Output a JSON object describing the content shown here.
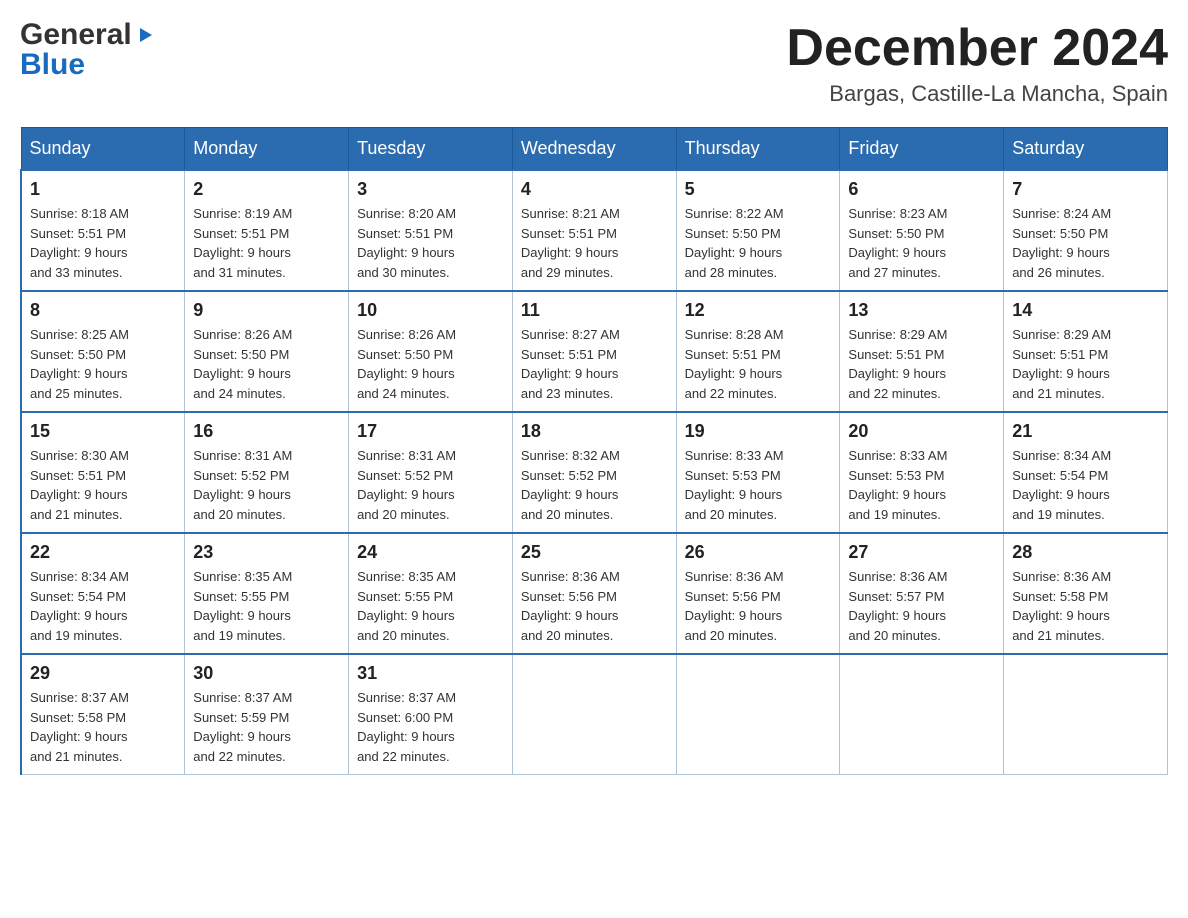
{
  "header": {
    "logo_general": "General",
    "logo_blue": "Blue",
    "month_title": "December 2024",
    "location": "Bargas, Castille-La Mancha, Spain"
  },
  "weekdays": [
    "Sunday",
    "Monday",
    "Tuesday",
    "Wednesday",
    "Thursday",
    "Friday",
    "Saturday"
  ],
  "weeks": [
    [
      {
        "day": "1",
        "sunrise": "8:18 AM",
        "sunset": "5:51 PM",
        "daylight": "9 hours and 33 minutes."
      },
      {
        "day": "2",
        "sunrise": "8:19 AM",
        "sunset": "5:51 PM",
        "daylight": "9 hours and 31 minutes."
      },
      {
        "day": "3",
        "sunrise": "8:20 AM",
        "sunset": "5:51 PM",
        "daylight": "9 hours and 30 minutes."
      },
      {
        "day": "4",
        "sunrise": "8:21 AM",
        "sunset": "5:51 PM",
        "daylight": "9 hours and 29 minutes."
      },
      {
        "day": "5",
        "sunrise": "8:22 AM",
        "sunset": "5:50 PM",
        "daylight": "9 hours and 28 minutes."
      },
      {
        "day": "6",
        "sunrise": "8:23 AM",
        "sunset": "5:50 PM",
        "daylight": "9 hours and 27 minutes."
      },
      {
        "day": "7",
        "sunrise": "8:24 AM",
        "sunset": "5:50 PM",
        "daylight": "9 hours and 26 minutes."
      }
    ],
    [
      {
        "day": "8",
        "sunrise": "8:25 AM",
        "sunset": "5:50 PM",
        "daylight": "9 hours and 25 minutes."
      },
      {
        "day": "9",
        "sunrise": "8:26 AM",
        "sunset": "5:50 PM",
        "daylight": "9 hours and 24 minutes."
      },
      {
        "day": "10",
        "sunrise": "8:26 AM",
        "sunset": "5:50 PM",
        "daylight": "9 hours and 24 minutes."
      },
      {
        "day": "11",
        "sunrise": "8:27 AM",
        "sunset": "5:51 PM",
        "daylight": "9 hours and 23 minutes."
      },
      {
        "day": "12",
        "sunrise": "8:28 AM",
        "sunset": "5:51 PM",
        "daylight": "9 hours and 22 minutes."
      },
      {
        "day": "13",
        "sunrise": "8:29 AM",
        "sunset": "5:51 PM",
        "daylight": "9 hours and 22 minutes."
      },
      {
        "day": "14",
        "sunrise": "8:29 AM",
        "sunset": "5:51 PM",
        "daylight": "9 hours and 21 minutes."
      }
    ],
    [
      {
        "day": "15",
        "sunrise": "8:30 AM",
        "sunset": "5:51 PM",
        "daylight": "9 hours and 21 minutes."
      },
      {
        "day": "16",
        "sunrise": "8:31 AM",
        "sunset": "5:52 PM",
        "daylight": "9 hours and 20 minutes."
      },
      {
        "day": "17",
        "sunrise": "8:31 AM",
        "sunset": "5:52 PM",
        "daylight": "9 hours and 20 minutes."
      },
      {
        "day": "18",
        "sunrise": "8:32 AM",
        "sunset": "5:52 PM",
        "daylight": "9 hours and 20 minutes."
      },
      {
        "day": "19",
        "sunrise": "8:33 AM",
        "sunset": "5:53 PM",
        "daylight": "9 hours and 20 minutes."
      },
      {
        "day": "20",
        "sunrise": "8:33 AM",
        "sunset": "5:53 PM",
        "daylight": "9 hours and 19 minutes."
      },
      {
        "day": "21",
        "sunrise": "8:34 AM",
        "sunset": "5:54 PM",
        "daylight": "9 hours and 19 minutes."
      }
    ],
    [
      {
        "day": "22",
        "sunrise": "8:34 AM",
        "sunset": "5:54 PM",
        "daylight": "9 hours and 19 minutes."
      },
      {
        "day": "23",
        "sunrise": "8:35 AM",
        "sunset": "5:55 PM",
        "daylight": "9 hours and 19 minutes."
      },
      {
        "day": "24",
        "sunrise": "8:35 AM",
        "sunset": "5:55 PM",
        "daylight": "9 hours and 20 minutes."
      },
      {
        "day": "25",
        "sunrise": "8:36 AM",
        "sunset": "5:56 PM",
        "daylight": "9 hours and 20 minutes."
      },
      {
        "day": "26",
        "sunrise": "8:36 AM",
        "sunset": "5:56 PM",
        "daylight": "9 hours and 20 minutes."
      },
      {
        "day": "27",
        "sunrise": "8:36 AM",
        "sunset": "5:57 PM",
        "daylight": "9 hours and 20 minutes."
      },
      {
        "day": "28",
        "sunrise": "8:36 AM",
        "sunset": "5:58 PM",
        "daylight": "9 hours and 21 minutes."
      }
    ],
    [
      {
        "day": "29",
        "sunrise": "8:37 AM",
        "sunset": "5:58 PM",
        "daylight": "9 hours and 21 minutes."
      },
      {
        "day": "30",
        "sunrise": "8:37 AM",
        "sunset": "5:59 PM",
        "daylight": "9 hours and 22 minutes."
      },
      {
        "day": "31",
        "sunrise": "8:37 AM",
        "sunset": "6:00 PM",
        "daylight": "9 hours and 22 minutes."
      },
      null,
      null,
      null,
      null
    ]
  ],
  "labels": {
    "sunrise": "Sunrise:",
    "sunset": "Sunset:",
    "daylight": "Daylight:"
  }
}
